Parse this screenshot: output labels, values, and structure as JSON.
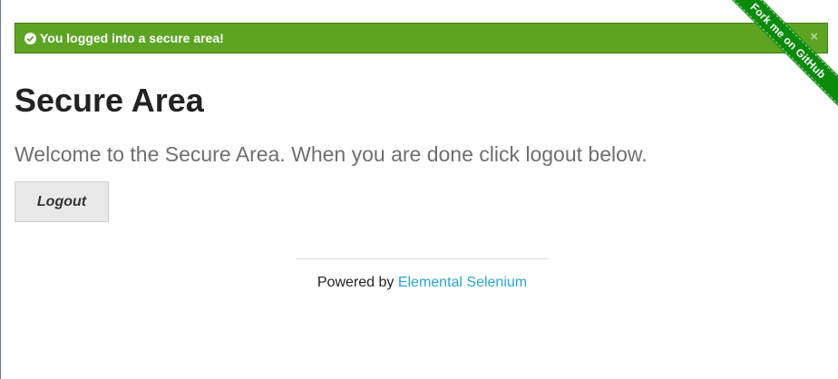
{
  "flash": {
    "message": "You logged into a secure area!",
    "close_label": "×",
    "icon": "check-circle-icon",
    "color": "#5da423"
  },
  "ribbon": {
    "label": "Fork me on GitHub",
    "color": "#0b8a0b"
  },
  "main": {
    "title": "Secure Area",
    "subheader": "Welcome to the Secure Area. When you are done click logout below.",
    "logout_label": "Logout"
  },
  "footer": {
    "prefix": "Powered by ",
    "link_text": "Elemental Selenium",
    "link_color": "#2ba6cb"
  }
}
